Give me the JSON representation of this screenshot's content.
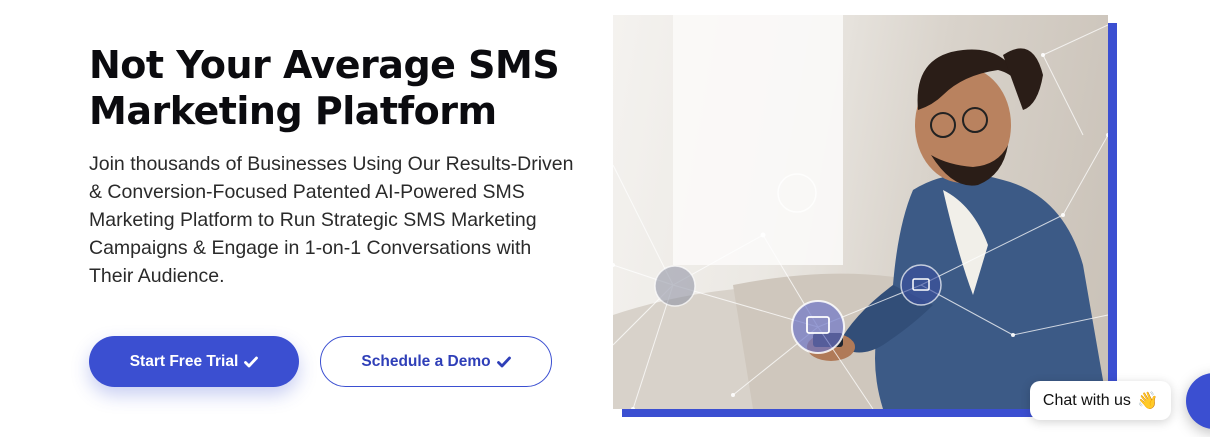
{
  "hero": {
    "title": "Not Your Average SMS Marketing Platform",
    "subtitle": "Join thousands of Businesses Using Our Results-Driven & Conversion-Focused Patented AI-Powered SMS Marketing Platform to Run Strategic SMS Marketing Campaigns & Engage in 1-on-1 Conversations with Their Audience.",
    "primary_button": {
      "label": "Start Free Trial",
      "icon": "check-icon"
    },
    "secondary_button": {
      "label": "Schedule a Demo",
      "icon": "check-icon"
    },
    "image": {
      "subject": "man-smiling-at-phone-photo",
      "overlay": "network-lines-with-icons"
    }
  },
  "chat": {
    "bubble_label": "Chat with us",
    "bubble_emoji": "👋",
    "launcher_icon": "chat-icon"
  },
  "colors": {
    "accent": "#3b4fd1",
    "heading": "#0b0b0f",
    "body_text": "#2a2a2a",
    "background": "#ffffff"
  }
}
